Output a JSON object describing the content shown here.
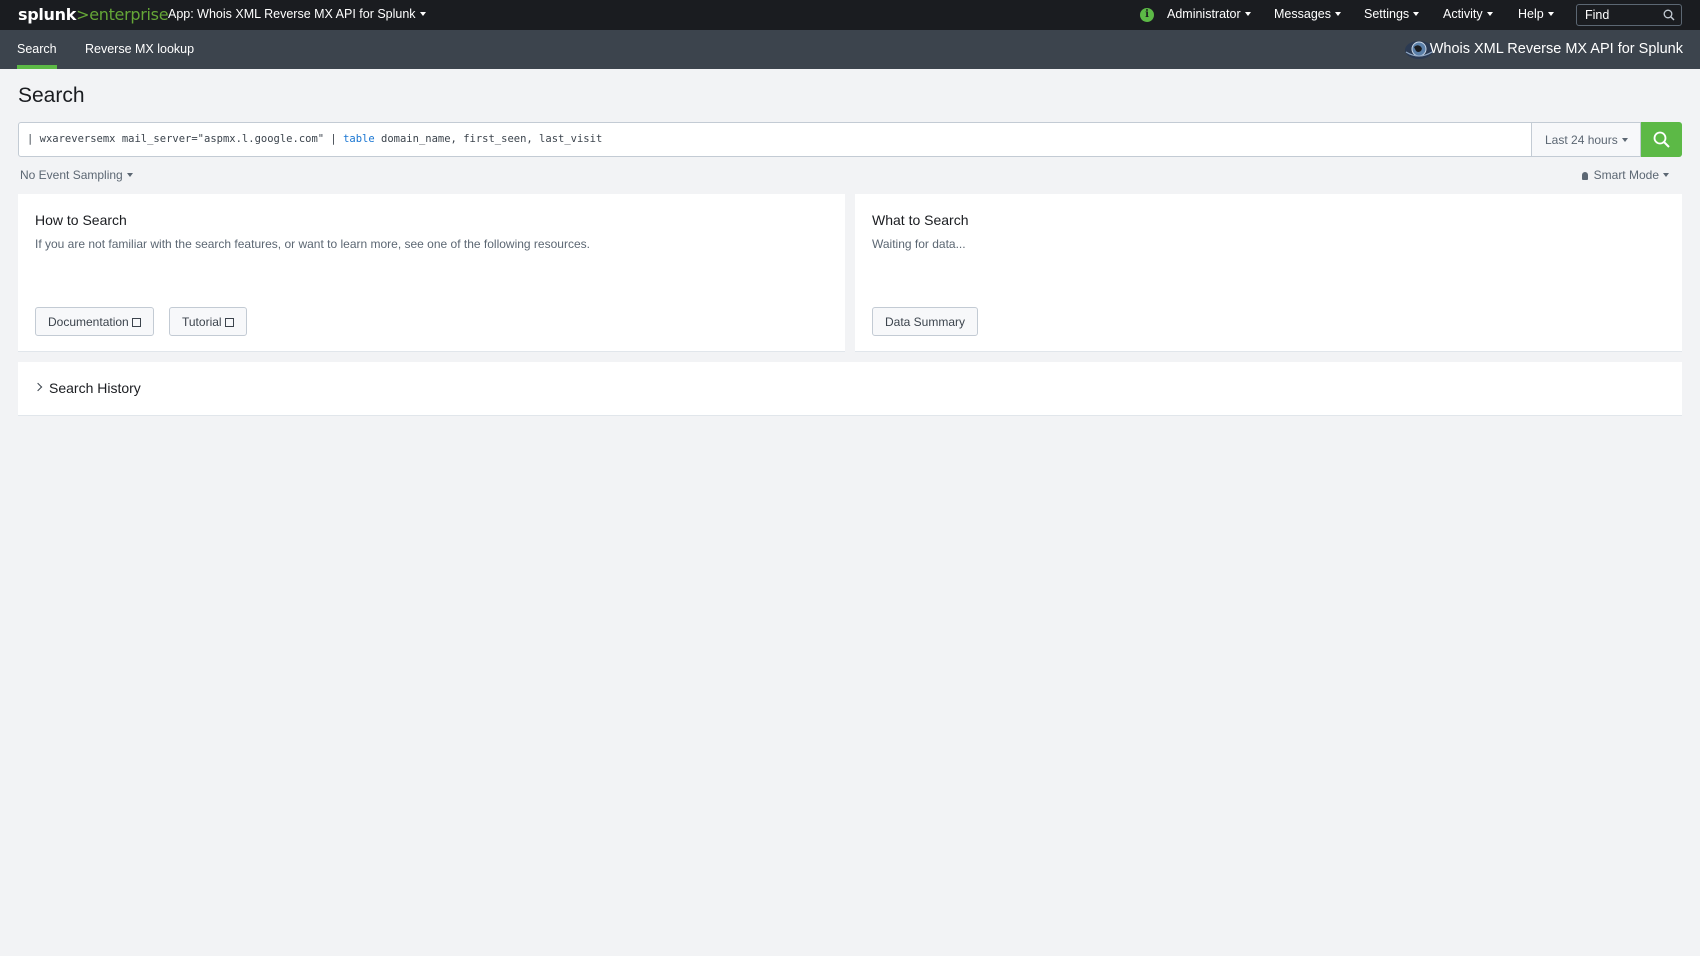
{
  "topbar": {
    "logo_brand": "splunk",
    "logo_sep": ">",
    "logo_product": "enterprise",
    "app_menu": "App: Whois XML Reverse MX API for Splunk",
    "status_icon": "i",
    "nav": [
      "Administrator",
      "Messages",
      "Settings",
      "Activity",
      "Help"
    ],
    "find_placeholder": "Find"
  },
  "appbar": {
    "tabs": [
      "Search",
      "Reverse MX lookup"
    ],
    "active_tab": "Search",
    "app_title": "Whois XML Reverse MX API for Splunk"
  },
  "page": {
    "title": "Search"
  },
  "search": {
    "query_prefix": "| wxareversemx mail_server=\"aspmx.l.google.com\" | ",
    "query_keyword": "table",
    "query_suffix": " domain_name, first_seen, last_visit",
    "time_range": "Last 24 hours",
    "sampling": "No Event Sampling",
    "mode": "Smart Mode"
  },
  "panels": {
    "how": {
      "title": "How to Search",
      "text": "If you are not familiar with the search features, or want to learn more, see one of the following resources.",
      "buttons": [
        "Documentation",
        "Tutorial"
      ]
    },
    "what": {
      "title": "What to Search",
      "text": "Waiting for data...",
      "button": "Data Summary"
    }
  },
  "history": {
    "label": "Search History"
  },
  "colors": {
    "accent": "#5cb946",
    "topbar": "#1a1c20",
    "appbar": "#3c444d",
    "keyword": "#1a76d2"
  }
}
